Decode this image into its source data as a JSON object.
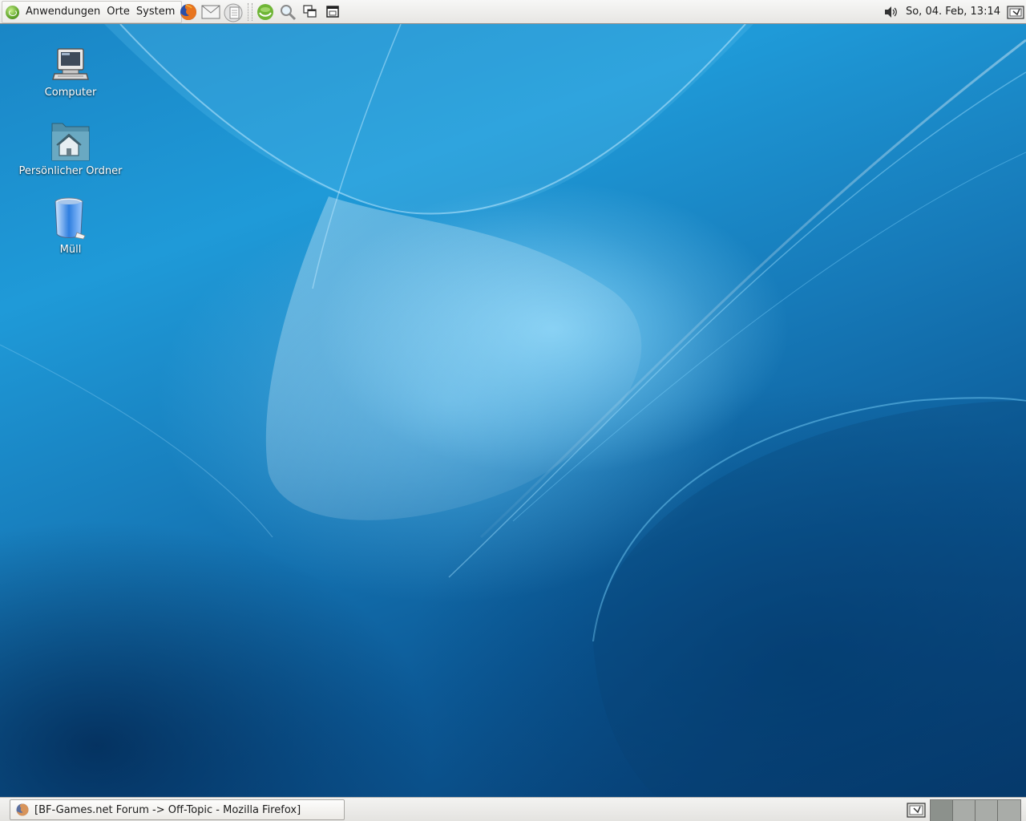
{
  "top_panel": {
    "menus": [
      {
        "label": "Anwendungen"
      },
      {
        "label": "Orte"
      },
      {
        "label": "System"
      }
    ],
    "launchers": [
      {
        "icon": "firefox-icon"
      },
      {
        "icon": "mail-icon"
      },
      {
        "icon": "document-icon"
      },
      {
        "icon": "opensuse-icon"
      },
      {
        "icon": "search-icon"
      },
      {
        "icon": "copy-windows-icon"
      },
      {
        "icon": "window-icon"
      }
    ],
    "tray": {
      "volume_icon": "speaker-icon",
      "clock": "So, 04. Feb, 13:14",
      "notification_icon": "panel-applet-icon"
    }
  },
  "desktop": {
    "icons": [
      {
        "label": "Computer",
        "icon": "computer-icon"
      },
      {
        "label": "Persönlicher Ordner",
        "icon": "home-folder-icon"
      },
      {
        "label": "Müll",
        "icon": "trash-icon"
      }
    ]
  },
  "bottom_panel": {
    "tasks": [
      {
        "title": "[BF-Games.net Forum -> Off-Topic - Mozilla Firefox]",
        "icon": "firefox-icon"
      }
    ],
    "show_desktop_icon": "show-desktop-icon",
    "workspace_count": 4,
    "active_workspace": 1
  },
  "colors": {
    "wallpaper_light": "#8cdcff",
    "wallpaper_mid": "#1f9ad8",
    "wallpaper_dark": "#06386b",
    "panel": "#eceae6"
  }
}
